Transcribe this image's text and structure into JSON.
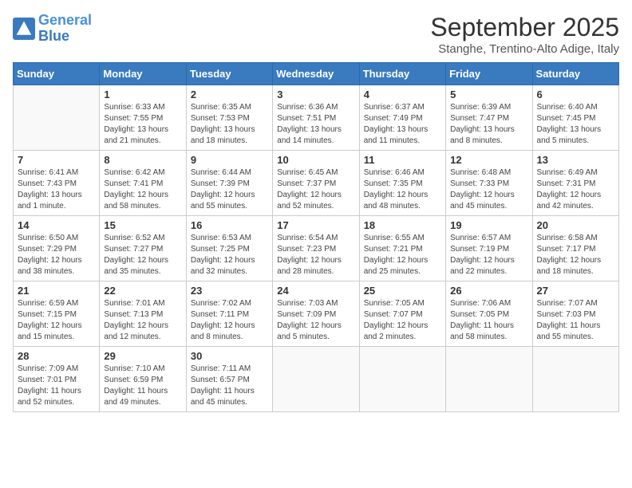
{
  "header": {
    "logo_line1": "General",
    "logo_line2": "Blue",
    "month": "September 2025",
    "location": "Stanghe, Trentino-Alto Adige, Italy"
  },
  "days_of_week": [
    "Sunday",
    "Monday",
    "Tuesday",
    "Wednesday",
    "Thursday",
    "Friday",
    "Saturday"
  ],
  "weeks": [
    [
      {
        "day": "",
        "sunrise": "",
        "sunset": "",
        "daylight": ""
      },
      {
        "day": "1",
        "sunrise": "6:33 AM",
        "sunset": "7:55 PM",
        "daylight": "13 hours and 21 minutes."
      },
      {
        "day": "2",
        "sunrise": "6:35 AM",
        "sunset": "7:53 PM",
        "daylight": "13 hours and 18 minutes."
      },
      {
        "day": "3",
        "sunrise": "6:36 AM",
        "sunset": "7:51 PM",
        "daylight": "13 hours and 14 minutes."
      },
      {
        "day": "4",
        "sunrise": "6:37 AM",
        "sunset": "7:49 PM",
        "daylight": "13 hours and 11 minutes."
      },
      {
        "day": "5",
        "sunrise": "6:39 AM",
        "sunset": "7:47 PM",
        "daylight": "13 hours and 8 minutes."
      },
      {
        "day": "6",
        "sunrise": "6:40 AM",
        "sunset": "7:45 PM",
        "daylight": "13 hours and 5 minutes."
      }
    ],
    [
      {
        "day": "7",
        "sunrise": "6:41 AM",
        "sunset": "7:43 PM",
        "daylight": "13 hours and 1 minute."
      },
      {
        "day": "8",
        "sunrise": "6:42 AM",
        "sunset": "7:41 PM",
        "daylight": "12 hours and 58 minutes."
      },
      {
        "day": "9",
        "sunrise": "6:44 AM",
        "sunset": "7:39 PM",
        "daylight": "12 hours and 55 minutes."
      },
      {
        "day": "10",
        "sunrise": "6:45 AM",
        "sunset": "7:37 PM",
        "daylight": "12 hours and 52 minutes."
      },
      {
        "day": "11",
        "sunrise": "6:46 AM",
        "sunset": "7:35 PM",
        "daylight": "12 hours and 48 minutes."
      },
      {
        "day": "12",
        "sunrise": "6:48 AM",
        "sunset": "7:33 PM",
        "daylight": "12 hours and 45 minutes."
      },
      {
        "day": "13",
        "sunrise": "6:49 AM",
        "sunset": "7:31 PM",
        "daylight": "12 hours and 42 minutes."
      }
    ],
    [
      {
        "day": "14",
        "sunrise": "6:50 AM",
        "sunset": "7:29 PM",
        "daylight": "12 hours and 38 minutes."
      },
      {
        "day": "15",
        "sunrise": "6:52 AM",
        "sunset": "7:27 PM",
        "daylight": "12 hours and 35 minutes."
      },
      {
        "day": "16",
        "sunrise": "6:53 AM",
        "sunset": "7:25 PM",
        "daylight": "12 hours and 32 minutes."
      },
      {
        "day": "17",
        "sunrise": "6:54 AM",
        "sunset": "7:23 PM",
        "daylight": "12 hours and 28 minutes."
      },
      {
        "day": "18",
        "sunrise": "6:55 AM",
        "sunset": "7:21 PM",
        "daylight": "12 hours and 25 minutes."
      },
      {
        "day": "19",
        "sunrise": "6:57 AM",
        "sunset": "7:19 PM",
        "daylight": "12 hours and 22 minutes."
      },
      {
        "day": "20",
        "sunrise": "6:58 AM",
        "sunset": "7:17 PM",
        "daylight": "12 hours and 18 minutes."
      }
    ],
    [
      {
        "day": "21",
        "sunrise": "6:59 AM",
        "sunset": "7:15 PM",
        "daylight": "12 hours and 15 minutes."
      },
      {
        "day": "22",
        "sunrise": "7:01 AM",
        "sunset": "7:13 PM",
        "daylight": "12 hours and 12 minutes."
      },
      {
        "day": "23",
        "sunrise": "7:02 AM",
        "sunset": "7:11 PM",
        "daylight": "12 hours and 8 minutes."
      },
      {
        "day": "24",
        "sunrise": "7:03 AM",
        "sunset": "7:09 PM",
        "daylight": "12 hours and 5 minutes."
      },
      {
        "day": "25",
        "sunrise": "7:05 AM",
        "sunset": "7:07 PM",
        "daylight": "12 hours and 2 minutes."
      },
      {
        "day": "26",
        "sunrise": "7:06 AM",
        "sunset": "7:05 PM",
        "daylight": "11 hours and 58 minutes."
      },
      {
        "day": "27",
        "sunrise": "7:07 AM",
        "sunset": "7:03 PM",
        "daylight": "11 hours and 55 minutes."
      }
    ],
    [
      {
        "day": "28",
        "sunrise": "7:09 AM",
        "sunset": "7:01 PM",
        "daylight": "11 hours and 52 minutes."
      },
      {
        "day": "29",
        "sunrise": "7:10 AM",
        "sunset": "6:59 PM",
        "daylight": "11 hours and 49 minutes."
      },
      {
        "day": "30",
        "sunrise": "7:11 AM",
        "sunset": "6:57 PM",
        "daylight": "11 hours and 45 minutes."
      },
      {
        "day": "",
        "sunrise": "",
        "sunset": "",
        "daylight": ""
      },
      {
        "day": "",
        "sunrise": "",
        "sunset": "",
        "daylight": ""
      },
      {
        "day": "",
        "sunrise": "",
        "sunset": "",
        "daylight": ""
      },
      {
        "day": "",
        "sunrise": "",
        "sunset": "",
        "daylight": ""
      }
    ]
  ]
}
